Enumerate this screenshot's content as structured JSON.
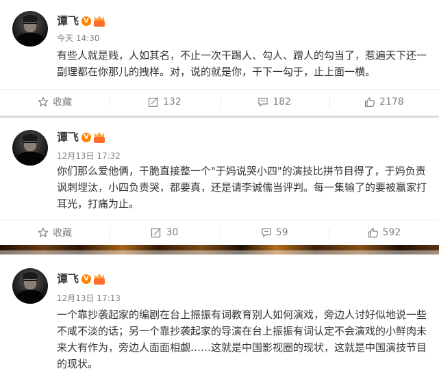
{
  "posts": [
    {
      "author": "谭飞",
      "time": "今天 14:30",
      "text": "有些人就是贱，人如其名，不止一次干踢人、勾人、蹭人的勾当了，惹遍天下还一副理都在你那儿的拽样。对，说的就是你，干下一勾于，止上面一横。",
      "actions": {
        "favorite": "收藏",
        "repost": "132",
        "comment": "182",
        "like": "2178"
      }
    },
    {
      "author": "谭飞",
      "time": "12月13日 17:32",
      "text": "你们那么爱他俩，干脆直接整一个\"于妈说哭小四\"的演技比拼节目得了，于妈负责讽刺埋汰，小四负责哭，都要真，还是请李诚儒当评判。每一集输了的要被赢家打耳光，打痛为止。",
      "actions": {
        "favorite": "收藏",
        "repost": "30",
        "comment": "59",
        "like": "592"
      }
    },
    {
      "author": "谭飞",
      "time": "12月13日 17:13",
      "text": "一个靠抄袭起家的编剧在台上振振有词教育别人如何演戏，旁边人讨好似地说一些不咸不淡的话；另一个靠抄袭起家的导演在台上振振有词认定不会演戏的小鲜肉未来大有作为，旁边人面面相觑……这就是中国影视圈的现状，这就是中国演技节目的现状。"
    }
  ],
  "badges": {
    "verified": "V"
  },
  "colors": {
    "verified_badge": "#ff8200",
    "level_badge": "#ff6d2d",
    "text": "#333333",
    "meta": "#808080"
  }
}
